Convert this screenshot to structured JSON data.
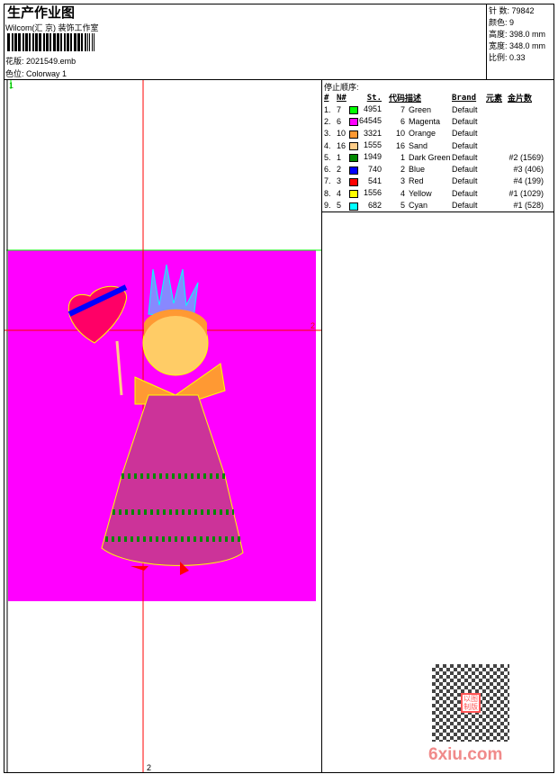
{
  "header": {
    "title": "生产作业图",
    "company": "Wilcom(汇 京) 装饰工作室",
    "design_label": "花版:",
    "design_file": "2021549.emb",
    "colorway_label": "色位:",
    "colorway": "Colorway 1"
  },
  "info": {
    "stitches": "针 数: 79842",
    "colors": "颜色: 9",
    "height": "高度: 398.0 mm",
    "width": "宽度: 348.0 mm",
    "scale": "比例: 0.33"
  },
  "stop_sequence": {
    "title": "停止顺序:",
    "columns": [
      "#",
      "N#",
      "St.",
      "代码",
      "描述",
      "Brand",
      "元素",
      "金片数"
    ],
    "rows": [
      {
        "n": "1.",
        "num": "7",
        "color": "#00ff00",
        "st": "4951",
        "code": "7",
        "desc": "Green",
        "brand": "Default",
        "seq": ""
      },
      {
        "n": "2.",
        "num": "6",
        "color": "#ff00ff",
        "st": "64545",
        "code": "6",
        "desc": "Magenta",
        "brand": "Default",
        "seq": ""
      },
      {
        "n": "3.",
        "num": "10",
        "color": "#ff9933",
        "st": "3321",
        "code": "10",
        "desc": "Orange",
        "brand": "Default",
        "seq": ""
      },
      {
        "n": "4.",
        "num": "16",
        "color": "#ffcc88",
        "st": "1555",
        "code": "16",
        "desc": "Sand",
        "brand": "Default",
        "seq": ""
      },
      {
        "n": "5.",
        "num": "1",
        "color": "#008800",
        "st": "1949",
        "code": "1",
        "desc": "Dark Green",
        "brand": "Default",
        "seq": "#2 (1569)"
      },
      {
        "n": "6.",
        "num": "2",
        "color": "#0000ff",
        "st": "740",
        "code": "2",
        "desc": "Blue",
        "brand": "Default",
        "seq": "#3 (406)"
      },
      {
        "n": "7.",
        "num": "3",
        "color": "#ff0000",
        "st": "541",
        "code": "3",
        "desc": "Red",
        "brand": "Default",
        "seq": "#4 (199)"
      },
      {
        "n": "8.",
        "num": "4",
        "color": "#ffff00",
        "st": "1556",
        "code": "4",
        "desc": "Yellow",
        "brand": "Default",
        "seq": "#1 (1029)"
      },
      {
        "n": "9.",
        "num": "5",
        "color": "#00ffff",
        "st": "682",
        "code": "5",
        "desc": "Cyan",
        "brand": "Default",
        "seq": "#1 (528)"
      }
    ]
  },
  "canvas": {
    "marker_top": "1",
    "marker_bottom": "2",
    "marker_right": "2",
    "background": "#ff00ff"
  },
  "watermark": {
    "text": "6xiu.com",
    "stamp": "以图制版"
  }
}
